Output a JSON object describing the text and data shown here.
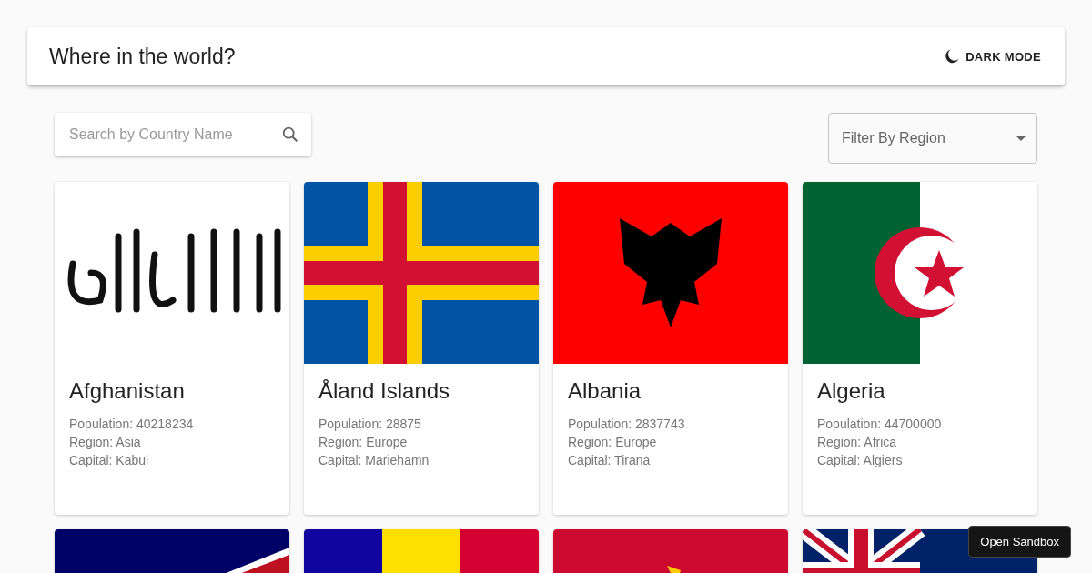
{
  "header": {
    "title": "Where in the world?",
    "mode_button": "DARK MODE"
  },
  "search": {
    "placeholder": "Search by Country Name"
  },
  "filter": {
    "placeholder": "Filter By Region"
  },
  "cards": [
    {
      "kind": "afghanistan",
      "name": "Afghanistan",
      "details": [
        "Population: 40218234",
        "Region: Asia",
        "Capital: Kabul"
      ]
    },
    {
      "kind": "aland",
      "name": "Åland Islands",
      "details": [
        "Population: 28875",
        "Region: Europe",
        "Capital: Mariehamn"
      ]
    },
    {
      "kind": "albania",
      "name": "Albania",
      "details": [
        "Population: 2837743",
        "Region: Europe",
        "Capital: Tirana"
      ]
    },
    {
      "kind": "algeria",
      "name": "Algeria",
      "details": [
        "Population: 44700000",
        "Region: Africa",
        "Capital: Algiers"
      ]
    },
    {
      "kind": "american_samoa"
    },
    {
      "kind": "andorra"
    },
    {
      "kind": "angola"
    },
    {
      "kind": "anguilla"
    }
  ],
  "sandbox_button": "Open Sandbox"
}
